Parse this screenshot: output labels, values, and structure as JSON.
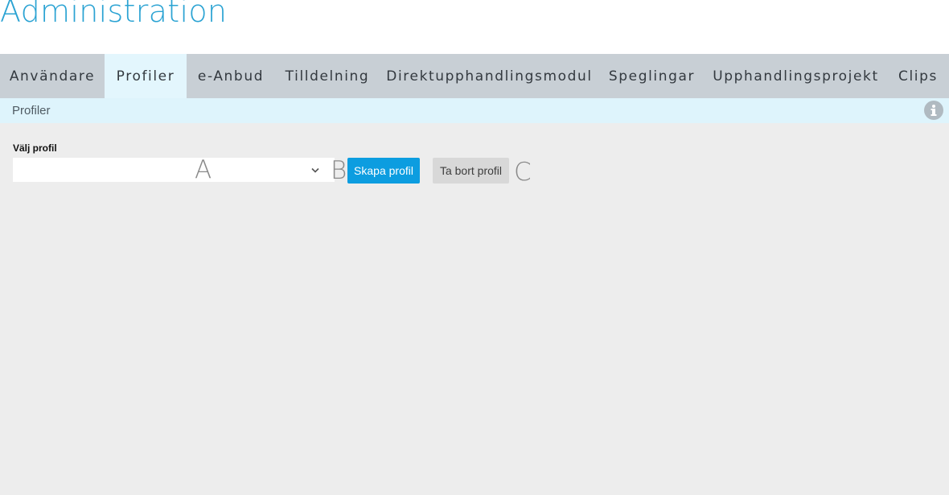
{
  "header": {
    "title": "Administration"
  },
  "tabs": [
    {
      "label": "Användare",
      "active": false
    },
    {
      "label": "Profiler",
      "active": true
    },
    {
      "label": "e-Anbud",
      "active": false
    },
    {
      "label": "Tilldelning",
      "active": false
    },
    {
      "label": "Direktupphandlingsmodul",
      "active": false
    },
    {
      "label": "Speglingar",
      "active": false
    },
    {
      "label": "Upphandlingsprojekt",
      "active": false
    },
    {
      "label": "Clips",
      "active": false
    }
  ],
  "subheader": {
    "title": "Profiler",
    "info_icon": "info-icon"
  },
  "form": {
    "profile_label": "Välj profil",
    "profile_select_value": "",
    "create_button": "Skapa profil",
    "delete_button": "Ta bort profil"
  },
  "markers": {
    "a": "A",
    "b": "B",
    "c": "C"
  },
  "colors": {
    "title": "#2ba3d3",
    "tabbar": "#c8cfd5",
    "tab_active": "#e3f6fd",
    "subbar": "#def4fc",
    "primary_button": "#0c9de0",
    "secondary_button": "#d8d8d8",
    "background": "#ededed"
  }
}
